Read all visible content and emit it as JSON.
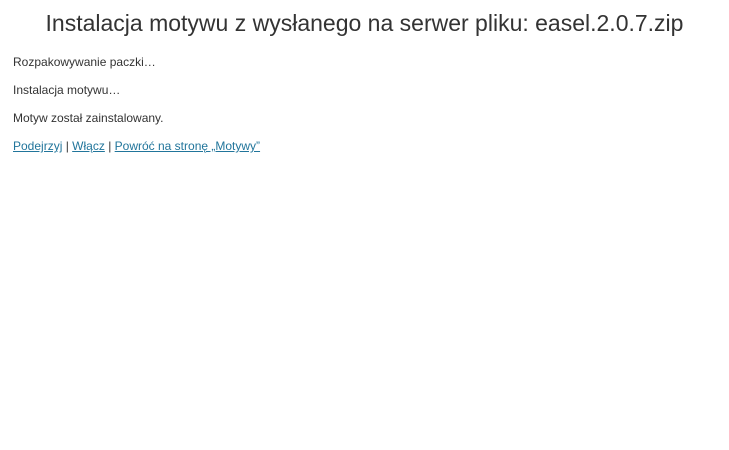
{
  "title": "Instalacja motywu z wysłanego na serwer pliku: easel.2.0.7.zip",
  "messages": [
    "Rozpakowywanie paczki…",
    "Instalacja motywu…",
    "Motyw został zainstalowany."
  ],
  "actions": {
    "preview_label": "Podejrzyj",
    "activate_label": "Włącz",
    "back_label": "Powróć na stronę „Motywy”",
    "separator": "|"
  },
  "colors": {
    "link": "#21759b",
    "text": "#333333",
    "background": "#ffffff"
  }
}
